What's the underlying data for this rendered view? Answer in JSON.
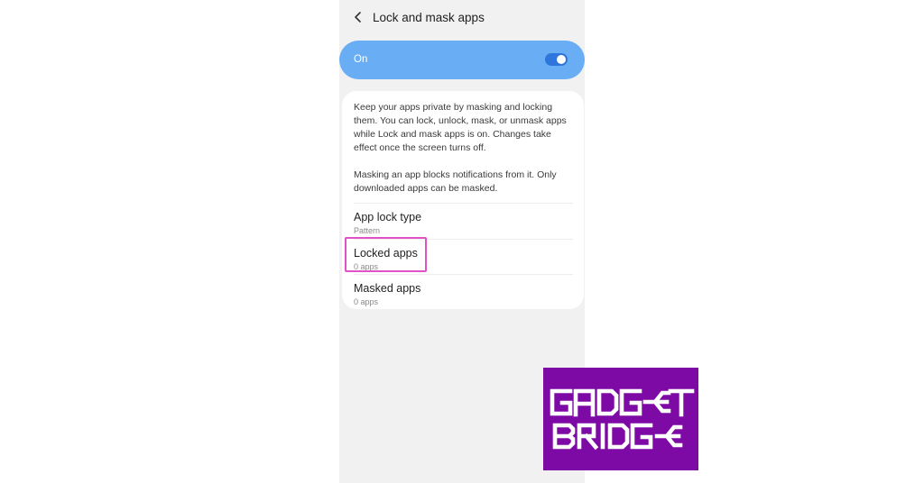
{
  "header": {
    "title": "Lock and mask apps",
    "back_icon": "chevron-left-icon"
  },
  "master_switch": {
    "label": "On",
    "state": "on",
    "color": "#69aef5",
    "toggle_color": "#2f76dc"
  },
  "info": {
    "paragraph1": "Keep your apps private by masking and locking them. You can lock, unlock, mask, or unmask apps while Lock and mask apps is on. Changes take effect once the screen turns off.",
    "paragraph2": "Masking an app blocks notifications from it. Only downloaded apps can be masked."
  },
  "settings": [
    {
      "title": "App lock type",
      "subtitle": "Pattern"
    },
    {
      "title": "Locked apps",
      "subtitle": "0 apps",
      "highlighted": true
    },
    {
      "title": "Masked apps",
      "subtitle": "0 apps"
    }
  ],
  "highlight_color": "#e052c5",
  "watermark": {
    "line1": "GADGET",
    "line2": "BRIDGE",
    "background": "#7e0aa6"
  }
}
